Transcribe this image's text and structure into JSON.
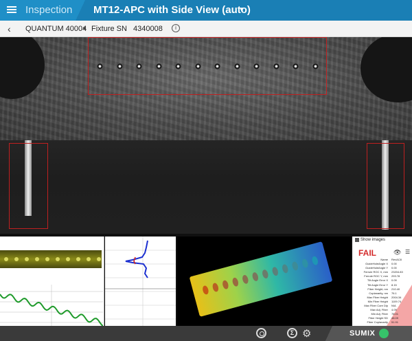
{
  "titlebar": {
    "section": "Inspection",
    "document_title": "MT12-APC with Side View (auto)"
  },
  "subheader": {
    "model": "QUANTUM 40004",
    "fixture_label": "Fixture SN",
    "fixture_value": "4340008",
    "info_glyph": "i"
  },
  "results": {
    "show_images_label": "Show images",
    "status": "FAIL",
    "status_color": "#d42a2a",
    "rows": [
      {
        "k": "Name",
        "v": "RevAC8"
      },
      {
        "k": "GuideHoleAngle X",
        "v": "0.00"
      },
      {
        "k": "GuideHoleAngle Y",
        "v": "0.00"
      },
      {
        "k": "Ferrule ROC X, mm",
        "v": "23204.83"
      },
      {
        "k": "Ferrule ROC Y, mm",
        "v": "293.78"
      },
      {
        "k": "Tilt Angle Error X",
        "v": "0.09"
      },
      {
        "k": "Tilt Angle Error Y",
        "v": "8.15"
      },
      {
        "k": "Fiber Height, nm",
        "v": "210.40"
      },
      {
        "k": "Coplanarity, nm",
        "v": "76.1"
      },
      {
        "k": "Max Fiber Height",
        "v": "2004.34"
      },
      {
        "k": "Min Fiber Height",
        "v": "1109.74"
      },
      {
        "k": "Max Fiber Core Dip",
        "v": "N/A"
      },
      {
        "k": "Max Adj. Fiber",
        "v": "4.09"
      },
      {
        "k": "Min Adj. Fiber",
        "v": "78.01"
      },
      {
        "k": "Fiber Height SD",
        "v": "48.09"
      },
      {
        "k": "Fiber Coplanarity",
        "v": "51.91"
      },
      {
        "k": "Coplanarity Max",
        "v": "2.04"
      }
    ]
  },
  "statusbar": {
    "brand": "SUMIX",
    "status_led_color": "#36c26a",
    "sigma_glyph": "Σ",
    "gear_glyph": "⚙"
  },
  "icons": {
    "menu": "hamburger-menu-icon",
    "back": "chevron-left-icon",
    "dropdown": "caret-down-icon",
    "info": "info-icon",
    "shutter": "shutter-icon",
    "statistics": "sigma-icon",
    "settings": "gear-icon",
    "visibility": "eye-icon",
    "more": "hamburger-menu-icon"
  }
}
